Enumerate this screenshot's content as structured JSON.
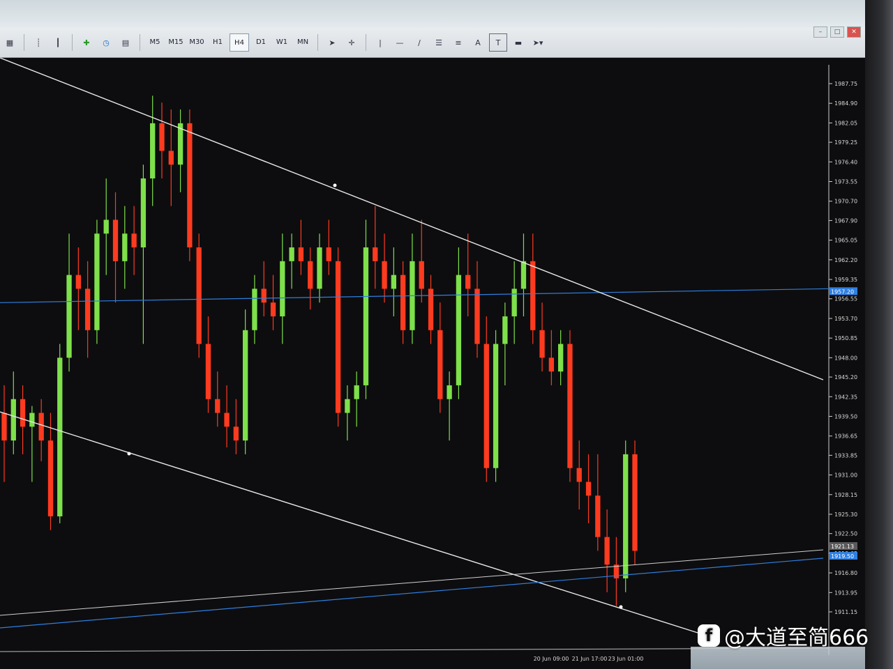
{
  "toolbar": {
    "timeframes": [
      "M5",
      "M15",
      "M30",
      "H1",
      "H4",
      "D1",
      "W1",
      "MN"
    ],
    "active_timeframe": "H4",
    "text_tool_label": "A",
    "text_label_tool": "T"
  },
  "watermark": {
    "text": "@大道至简666"
  },
  "chart_data": {
    "type": "candlestick",
    "y_ticks": [
      "1987.75",
      "1984.90",
      "1982.05",
      "1979.25",
      "1976.40",
      "1973.55",
      "1970.70",
      "1967.90",
      "1965.05",
      "1962.20",
      "1959.35",
      "1956.55",
      "1953.70",
      "1950.85",
      "1948.00",
      "1945.20",
      "1942.35",
      "1939.50",
      "1936.65",
      "1933.85",
      "1931.00",
      "1928.15",
      "1925.30",
      "1922.50",
      "1919.65",
      "1916.80",
      "1913.95",
      "1911.15"
    ],
    "x_ticks": [
      "20 Jun 09:00",
      "21 Jun 17:00",
      "23 Jun 01:00"
    ],
    "price_tags": [
      "1957.20",
      "1921.13",
      "1919.50"
    ],
    "colors": {
      "bull": "#7ee04a",
      "bear": "#ff3b1f",
      "horizontal": "#2f7fe0",
      "trend": "#e8e8e8"
    },
    "candles": [
      [
        1940,
        1944,
        1930,
        1936
      ],
      [
        1936,
        1946,
        1934,
        1942
      ],
      [
        1942,
        1944,
        1934,
        1938
      ],
      [
        1938,
        1941,
        1930,
        1940
      ],
      [
        1940,
        1942,
        1933,
        1936
      ],
      [
        1936,
        1940,
        1923,
        1925
      ],
      [
        1925,
        1950,
        1924,
        1948
      ],
      [
        1948,
        1966,
        1946,
        1960
      ],
      [
        1960,
        1964,
        1952,
        1958
      ],
      [
        1958,
        1962,
        1948,
        1952
      ],
      [
        1952,
        1968,
        1950,
        1966
      ],
      [
        1966,
        1974,
        1960,
        1968
      ],
      [
        1968,
        1972,
        1956,
        1962
      ],
      [
        1962,
        1970,
        1958,
        1966
      ],
      [
        1966,
        1970,
        1960,
        1964
      ],
      [
        1964,
        1976,
        1950,
        1974
      ],
      [
        1974,
        1986,
        1970,
        1982
      ],
      [
        1982,
        1985,
        1974,
        1978
      ],
      [
        1978,
        1984,
        1970,
        1976
      ],
      [
        1976,
        1984,
        1972,
        1982
      ],
      [
        1982,
        1984,
        1962,
        1964
      ],
      [
        1964,
        1966,
        1948,
        1950
      ],
      [
        1950,
        1954,
        1940,
        1942
      ],
      [
        1942,
        1946,
        1938,
        1940
      ],
      [
        1940,
        1944,
        1935,
        1938
      ],
      [
        1938,
        1942,
        1934,
        1936
      ],
      [
        1936,
        1955,
        1934,
        1952
      ],
      [
        1952,
        1960,
        1950,
        1958
      ],
      [
        1958,
        1962,
        1954,
        1956
      ],
      [
        1956,
        1960,
        1952,
        1954
      ],
      [
        1954,
        1966,
        1950,
        1962
      ],
      [
        1962,
        1966,
        1958,
        1964
      ],
      [
        1964,
        1968,
        1960,
        1962
      ],
      [
        1962,
        1964,
        1955,
        1958
      ],
      [
        1958,
        1966,
        1956,
        1964
      ],
      [
        1964,
        1968,
        1960,
        1962
      ],
      [
        1962,
        1964,
        1938,
        1940
      ],
      [
        1940,
        1944,
        1936,
        1942
      ],
      [
        1942,
        1946,
        1938,
        1944
      ],
      [
        1944,
        1968,
        1942,
        1964
      ],
      [
        1964,
        1970,
        1958,
        1962
      ],
      [
        1962,
        1966,
        1956,
        1958
      ],
      [
        1958,
        1964,
        1954,
        1960
      ],
      [
        1960,
        1962,
        1950,
        1952
      ],
      [
        1952,
        1966,
        1950,
        1962
      ],
      [
        1962,
        1968,
        1956,
        1958
      ],
      [
        1958,
        1960,
        1950,
        1952
      ],
      [
        1952,
        1956,
        1940,
        1942
      ],
      [
        1942,
        1946,
        1936,
        1944
      ],
      [
        1944,
        1964,
        1942,
        1960
      ],
      [
        1960,
        1966,
        1954,
        1958
      ],
      [
        1958,
        1962,
        1948,
        1950
      ],
      [
        1950,
        1954,
        1930,
        1932
      ],
      [
        1932,
        1952,
        1930,
        1950
      ],
      [
        1950,
        1956,
        1944,
        1954
      ],
      [
        1954,
        1962,
        1950,
        1958
      ],
      [
        1958,
        1966,
        1954,
        1962
      ],
      [
        1962,
        1966,
        1950,
        1952
      ],
      [
        1952,
        1956,
        1946,
        1948
      ],
      [
        1948,
        1952,
        1944,
        1946
      ],
      [
        1946,
        1952,
        1944,
        1950
      ],
      [
        1950,
        1952,
        1930,
        1932
      ],
      [
        1932,
        1936,
        1926,
        1930
      ],
      [
        1930,
        1934,
        1924,
        1928
      ],
      [
        1928,
        1934,
        1920,
        1922
      ],
      [
        1922,
        1926,
        1914,
        1918
      ],
      [
        1918,
        1922,
        1912,
        1916
      ],
      [
        1916,
        1936,
        1914,
        1934
      ],
      [
        1934,
        1936,
        1918,
        1920
      ]
    ]
  }
}
